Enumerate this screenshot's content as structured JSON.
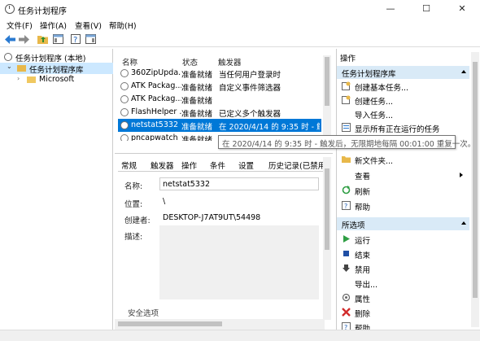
{
  "window": {
    "title": "任务计划程序"
  },
  "menu": {
    "file": "文件(F)",
    "action": "操作(A)",
    "view": "查看(V)",
    "help": "帮助(H)"
  },
  "tree": {
    "root": "任务计划程序 (本地)",
    "library": "任务计划程序库",
    "folder": "Microsoft"
  },
  "tasklist": {
    "headers": {
      "name": "名称",
      "status": "状态",
      "trigger": "触发器"
    },
    "rows": [
      {
        "name": "360ZipUpda...",
        "status": "准备就绪",
        "trigger": "当任何用户登录时"
      },
      {
        "name": "ATK Packag...",
        "status": "准备就绪",
        "trigger": "自定义事件筛选器"
      },
      {
        "name": "ATK Packag...",
        "status": "准备就绪",
        "trigger": ""
      },
      {
        "name": "FlashHelper ...",
        "status": "准备就绪",
        "trigger": "已定义多个触发器"
      },
      {
        "name": "netstat5332",
        "status": "准备就绪",
        "trigger": "在 2020/4/14 的 9:35 时 - 触发"
      },
      {
        "name": "pncapwatch",
        "status": "准备就绪",
        "trigger": ""
      }
    ],
    "tooltip": "在 2020/4/14 的 9:35 时 - 触发后，无限期地每隔 00:01:00 重复一次。"
  },
  "details": {
    "tabs": [
      "常规",
      "触发器",
      "操作",
      "条件",
      "设置",
      "历史记录(已禁用)"
    ],
    "name_label": "名称:",
    "name_value": "netstat5332",
    "location_label": "位置:",
    "location_value": "\\",
    "author_label": "创建者:",
    "author_value": "DESKTOP-J7AT9UT\\54498",
    "description_label": "描述:",
    "security_label": "安全选项"
  },
  "actions": {
    "header": "操作",
    "section1": "任务计划程序库",
    "items1": [
      {
        "label": "创建基本任务...",
        "icon": "create-basic-task-icon"
      },
      {
        "label": "创建任务...",
        "icon": "create-task-icon"
      },
      {
        "label": "导入任务...",
        "icon": "none"
      },
      {
        "label": "显示所有正在运行的任务",
        "icon": "running-tasks-icon"
      },
      {
        "label": "新文件夹...",
        "icon": "folder-icon"
      },
      {
        "label": "查看",
        "icon": "none"
      },
      {
        "label": "刷新",
        "icon": "refresh-icon"
      },
      {
        "label": "帮助",
        "icon": "help-icon"
      }
    ],
    "section2": "所选项",
    "items2": [
      {
        "label": "运行",
        "icon": "run-icon"
      },
      {
        "label": "结束",
        "icon": "end-icon"
      },
      {
        "label": "禁用",
        "icon": "disable-icon"
      },
      {
        "label": "导出...",
        "icon": "none"
      },
      {
        "label": "属性",
        "icon": "properties-icon"
      },
      {
        "label": "删除",
        "icon": "delete-icon"
      },
      {
        "label": "帮助",
        "icon": "help-icon"
      }
    ]
  },
  "colors": {
    "selection": "#0078d7",
    "section_bg": "#d9eaf7",
    "tree_selection": "#cce8ff"
  }
}
